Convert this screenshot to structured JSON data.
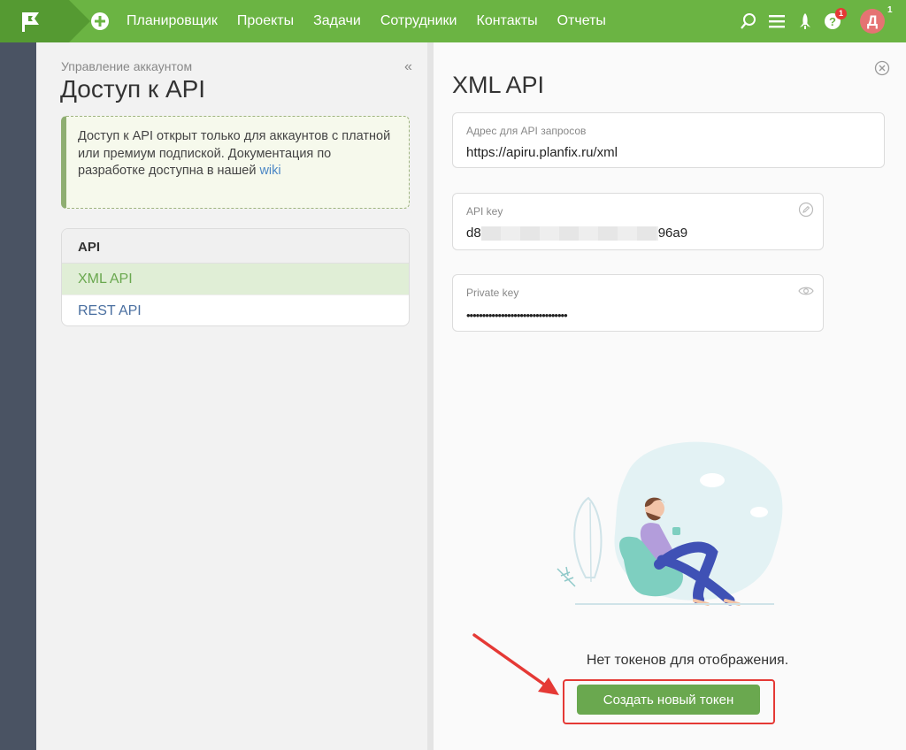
{
  "topbar": {
    "nav_items": [
      "Планировщик",
      "Проекты",
      "Задачи",
      "Сотрудники",
      "Контакты",
      "Отчеты"
    ],
    "help_badge": "1",
    "avatar_letter": "Д",
    "avatar_count": "1"
  },
  "left_panel": {
    "breadcrumb": "Управление аккаунтом",
    "title": "Доступ к API",
    "notice_text": "Доступ к API открыт только для аккаунтов с платной или премиум подпиской. Документация по разработке доступна в нашей",
    "notice_link": "wiki",
    "menu_header": "API",
    "menu_items": [
      "XML API",
      "REST API"
    ]
  },
  "right_panel": {
    "title": "XML API",
    "url_label": "Адрес для API запросов",
    "url_value": "https://apiru.planfix.ru/xml",
    "api_key_label": "API key",
    "api_key_prefix": "d8",
    "api_key_suffix": "96a9",
    "private_key_label": "Private key",
    "private_key_value": "••••••••••••••••••••••••••••••••",
    "empty_text": "Нет токенов для отображения.",
    "create_button": "Создать новый токен"
  },
  "colors": {
    "topbar": "#6bb443",
    "accent": "#6aa84f",
    "sidebar": "#4a5363",
    "highlight": "#e53935"
  },
  "icons": [
    "flag-icon",
    "add-icon",
    "search-icon",
    "menu-icon",
    "rocket-icon",
    "help-icon",
    "collapse-icon",
    "close-icon",
    "edit-icon",
    "eye-icon"
  ]
}
